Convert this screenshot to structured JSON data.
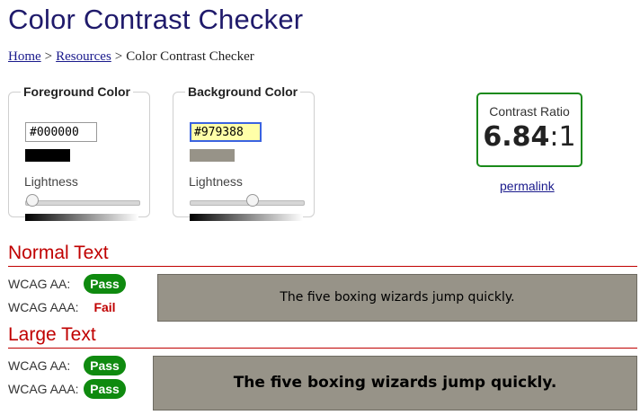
{
  "page": {
    "title": "Color Contrast Checker"
  },
  "breadcrumb": {
    "home": "Home",
    "sep1": ">",
    "resources": "Resources",
    "sep2": ">",
    "current": "Color Contrast Checker"
  },
  "foreground": {
    "legend": "Foreground Color",
    "hex": "#000000",
    "color": "#000000",
    "lightness_label": "Lightness",
    "lightness_pct": 0
  },
  "background": {
    "legend": "Background Color",
    "hex": "#979388",
    "color": "#979388",
    "lightness_label": "Lightness",
    "lightness_pct": 56
  },
  "ratio": {
    "label": "Contrast Ratio",
    "value": "6.84",
    "suffix": ":1",
    "permalink": "permalink"
  },
  "normal": {
    "heading": "Normal Text",
    "aa_label": "WCAG AA:",
    "aa_result": "Pass",
    "aaa_label": "WCAG AAA:",
    "aaa_result": "Fail",
    "sample": "The five boxing wizards jump quickly."
  },
  "large": {
    "heading": "Large Text",
    "aa_label": "WCAG AA:",
    "aa_result": "Pass",
    "aaa_label": "WCAG AAA:",
    "aaa_result": "Pass",
    "sample": "The five boxing wizards jump quickly."
  },
  "colors": {
    "pass": "#0f8a0f",
    "fail": "#c00000",
    "accent_border": "#1a8a1a",
    "heading": "#1f1a6b"
  }
}
